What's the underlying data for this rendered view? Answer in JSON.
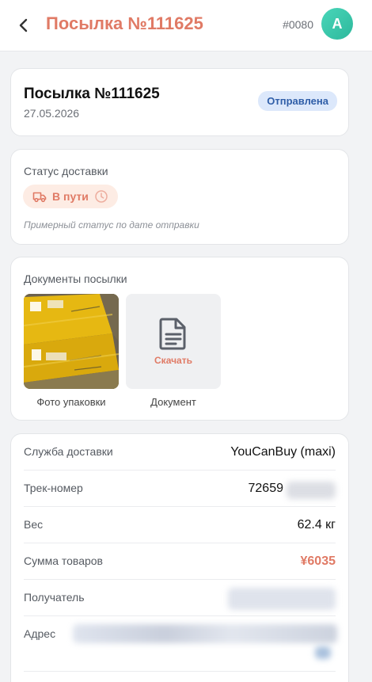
{
  "header": {
    "title": "Посылка №111625",
    "order_code": "#0080",
    "avatar_letter": "A",
    "back_icon": "chevron-left-icon"
  },
  "summary": {
    "title": "Посылка №111625",
    "date": "27.05.2026",
    "status_badge": "Отправлена"
  },
  "delivery_status": {
    "label": "Статус доставки",
    "status": "В пути",
    "hint": "Примерный статус по дате отправки"
  },
  "documents": {
    "label": "Документы посылки",
    "items": [
      {
        "caption": "Фото упаковки"
      },
      {
        "caption": "Документ",
        "action": "Скачать"
      }
    ]
  },
  "details": {
    "rows": [
      {
        "key": "Служба доставки",
        "value": "YouCanBuy (maxi)"
      },
      {
        "key": "Трек-номер",
        "value": "72659"
      },
      {
        "key": "Вес",
        "value": "62.4 кг"
      },
      {
        "key": "Сумма товаров",
        "value": "¥6035"
      },
      {
        "key": "Получатель",
        "value": ""
      },
      {
        "key": "Адрес",
        "value": ""
      }
    ]
  },
  "colors": {
    "accent": "#e07a65",
    "badge_bg": "#dce8fb",
    "badge_text": "#2f5ea8",
    "avatar": "#3ccaa9"
  }
}
